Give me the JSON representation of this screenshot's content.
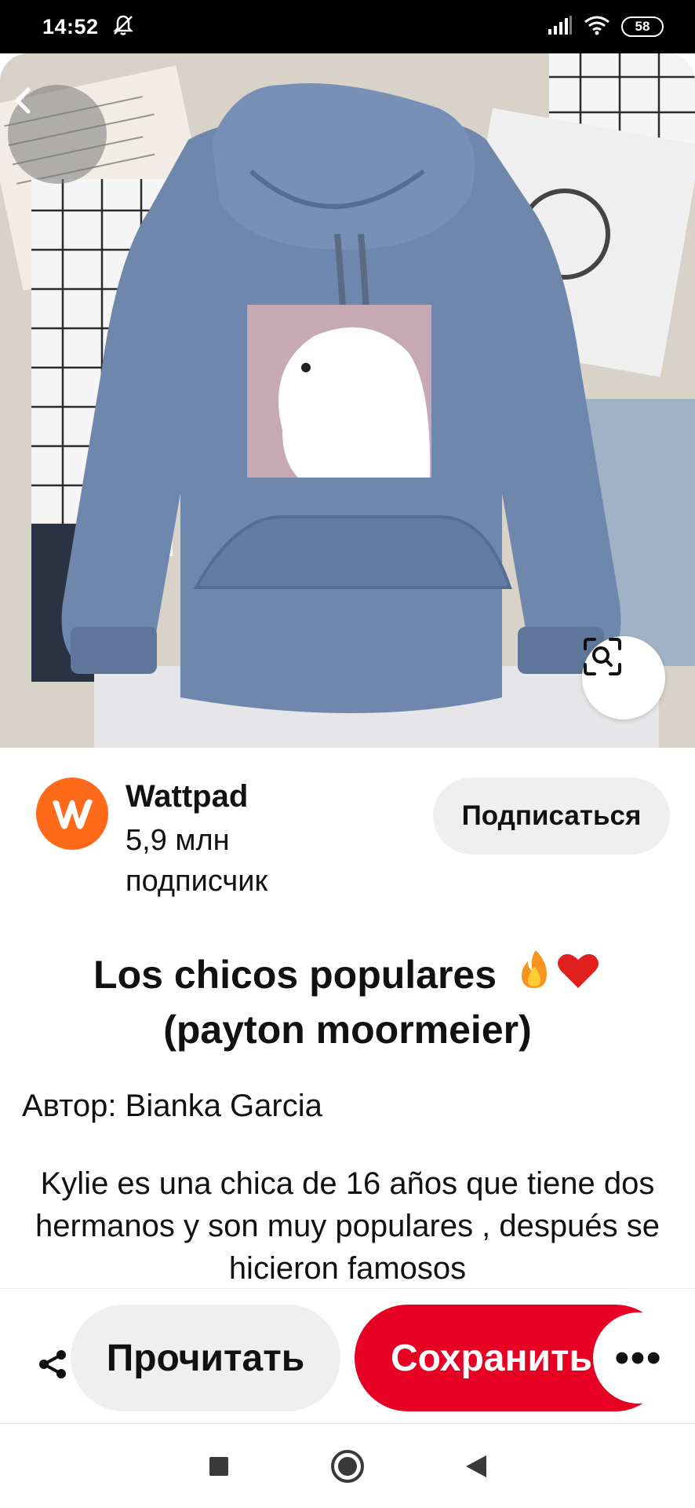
{
  "status_bar": {
    "time": "14:52",
    "battery": "58",
    "icons": [
      "mute-bell-icon",
      "signal-icon",
      "wifi-icon",
      "battery-icon"
    ]
  },
  "hero": {
    "description_icons": [
      "back-chevron-icon",
      "visual-search-icon"
    ],
    "colors": {
      "hoodie": "#6f87ad",
      "print": "#c7a9b4"
    }
  },
  "creator": {
    "name": "Wattpad",
    "followers": "5,9 млн подписчик",
    "follow_label": "Подписаться",
    "avatar_color": "#ff6a1a"
  },
  "pin": {
    "title": "Los chicos populares 🔥❤️ (payton moormeier)",
    "title_main": "Los chicos populares",
    "title_sub": "(payton moormeier)",
    "author": "Автор: Bianka Garcia",
    "description": "Kylie es una chica de 16 años que tiene dos hermanos y son muy populares , después se hicieron famosos"
  },
  "actions": {
    "read_label": "Прочитать",
    "save_label": "Сохранить",
    "more_label": "•••",
    "save_color": "#e60023"
  },
  "nav": {
    "icons": [
      "recents-square-icon",
      "home-circle-icon",
      "back-triangle-icon"
    ]
  }
}
